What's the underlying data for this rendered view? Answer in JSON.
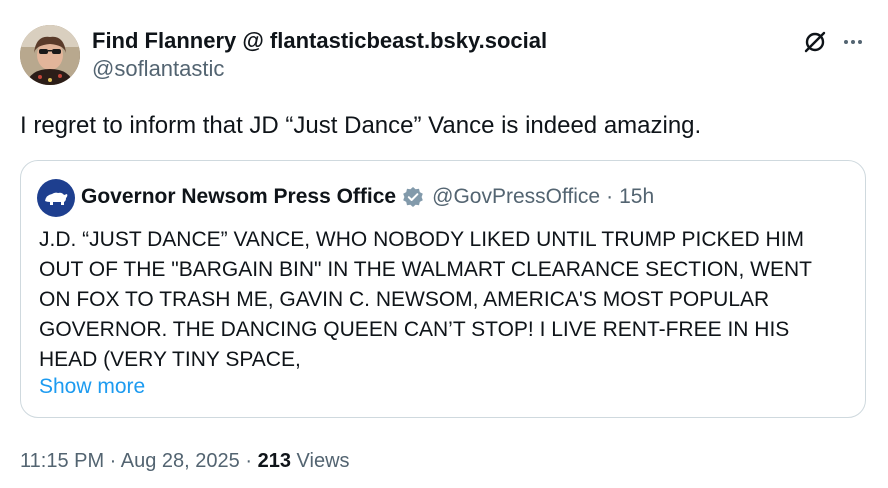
{
  "author": {
    "display_name": "Find Flannery @ flantasticbeast.bsky.social",
    "handle": "@soflantastic",
    "avatar_icon": "profile-photo"
  },
  "post": {
    "text": "I regret to inform that JD “Just Dance” Vance is indeed amazing.",
    "timestamp": "11:15 PM · Aug 28, 2025",
    "separator": "·",
    "views_count": "213",
    "views_label": "Views"
  },
  "actions": {
    "grok_icon": "grok-icon",
    "more_icon": "more-options-icon"
  },
  "quote": {
    "display_name": "Governor Newsom Press Office",
    "verified_icon": "verified-badge-icon",
    "handle": "@GovPressOffice",
    "separator": "·",
    "time": "15h",
    "text_lines": [
      "J.D. “JUST DANCE” VANCE, WHO NOBODY LIKED UNTIL TRUMP PICKED HIM",
      "OUT OF THE \"BARGAIN BIN\" IN THE WALMART CLEARANCE SECTION, WENT",
      "ON FOX TO TRASH ME, GAVIN C. NEWSOM, AMERICA'S MOST POPULAR",
      "GOVERNOR. THE DANCING QUEEN CAN’T STOP! I LIVE RENT-FREE IN HIS",
      "HEAD (VERY TINY SPACE,"
    ],
    "show_more": "Show more"
  },
  "colors": {
    "text_primary": "#0f1419",
    "text_secondary": "#536471",
    "link": "#1d9bf0",
    "border": "#cfd9de",
    "badge": "#829aab"
  }
}
